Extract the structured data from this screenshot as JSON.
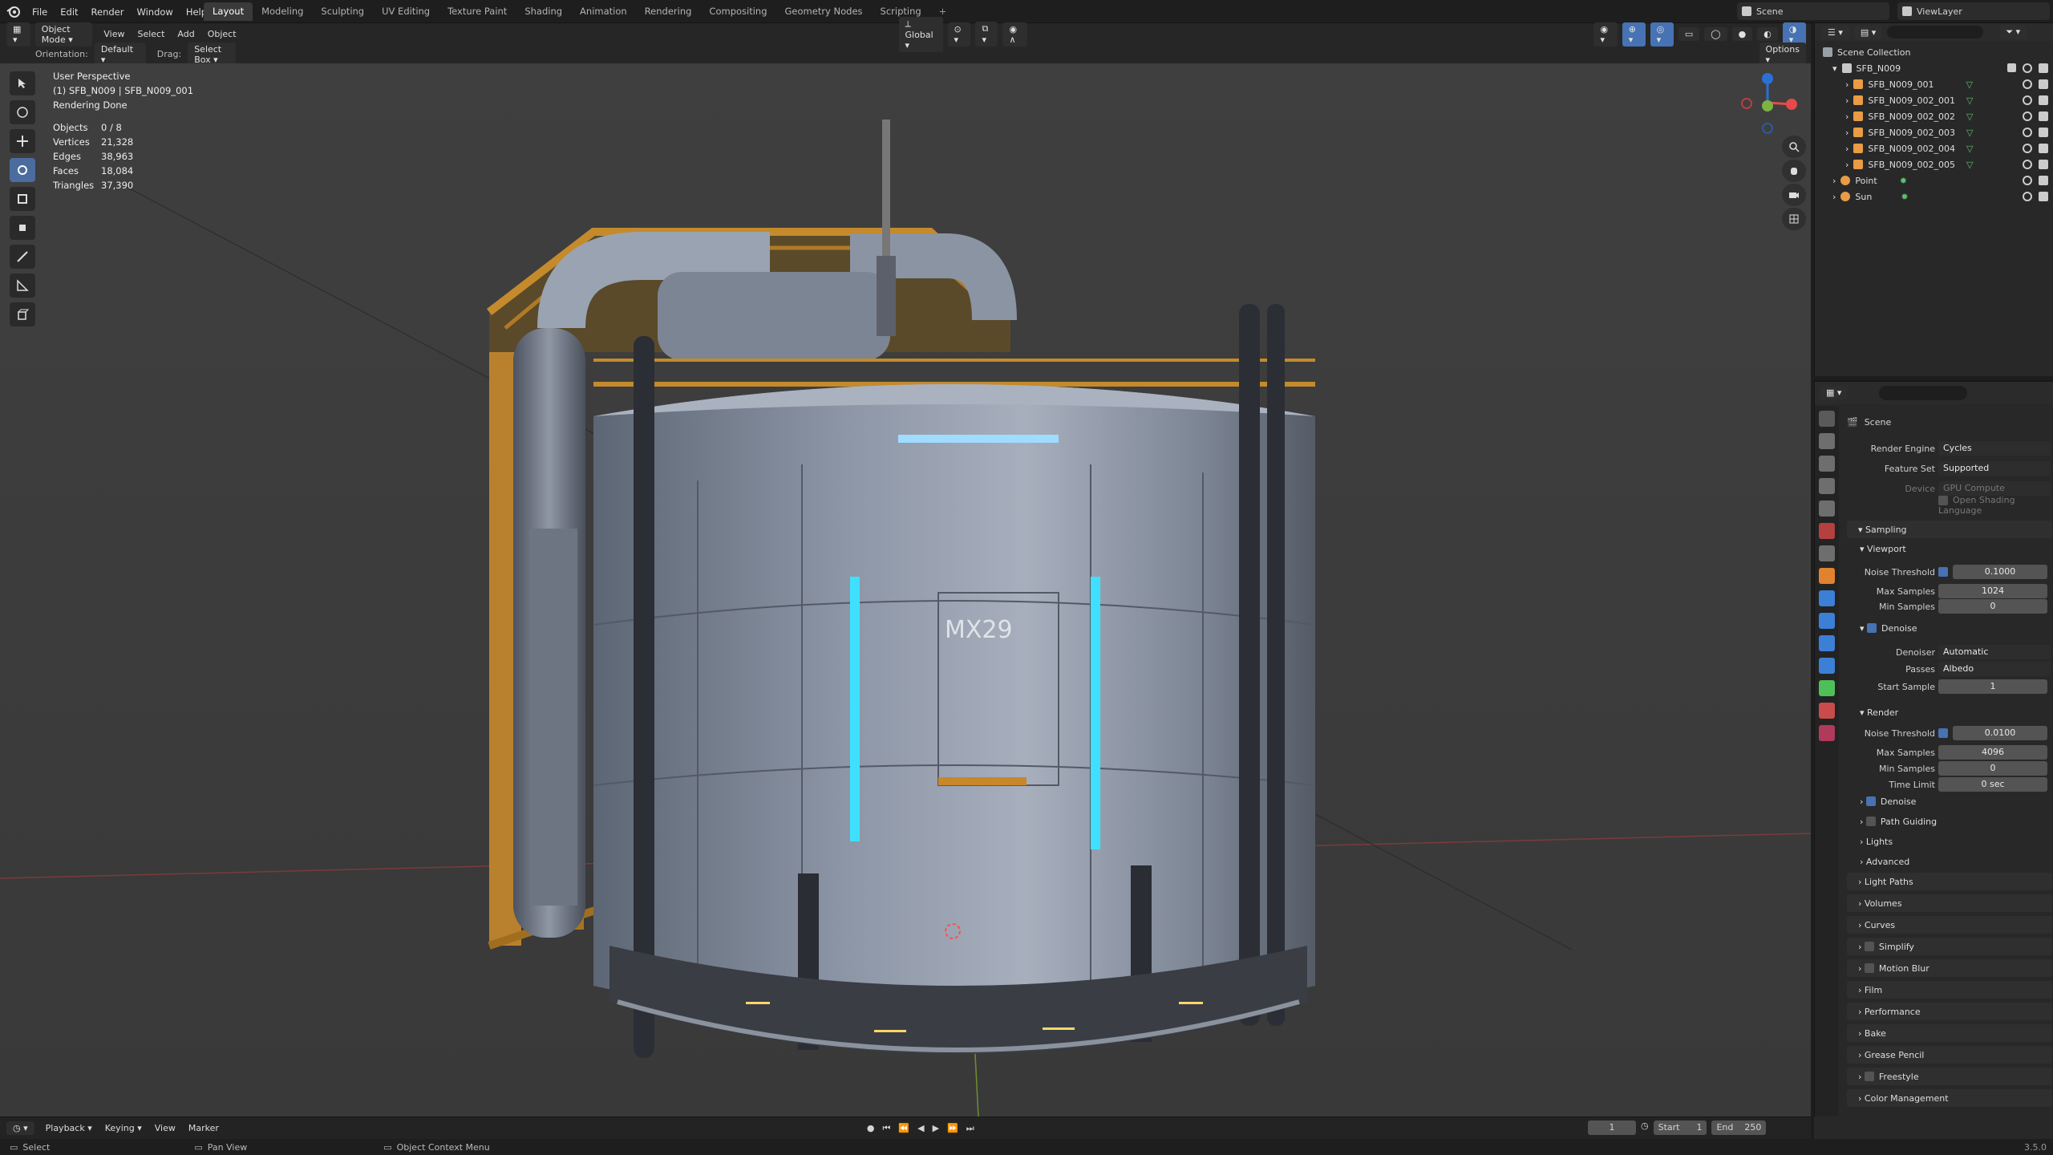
{
  "topbar": {
    "menus": [
      "File",
      "Edit",
      "Render",
      "Window",
      "Help"
    ],
    "workspaces": [
      "Layout",
      "Modeling",
      "Sculpting",
      "UV Editing",
      "Texture Paint",
      "Shading",
      "Animation",
      "Rendering",
      "Compositing",
      "Geometry Nodes",
      "Scripting"
    ],
    "active_workspace": "Layout",
    "scene": "Scene",
    "view_layer": "ViewLayer"
  },
  "viewport_header": {
    "mode": "Object Mode",
    "menus": [
      "View",
      "Select",
      "Add",
      "Object"
    ],
    "transform": "Global",
    "orientation_label": "Orientation:",
    "orientation_value": "Default",
    "drag_label": "Drag:",
    "drag_value": "Select Box",
    "options": "Options"
  },
  "overlay": {
    "perspective": "User Perspective",
    "object": "(1) SFB_N009 | SFB_N009_001",
    "render_status": "Rendering Done",
    "stats": [
      {
        "label": "Objects",
        "value": "0 / 8"
      },
      {
        "label": "Vertices",
        "value": "21,328"
      },
      {
        "label": "Edges",
        "value": "38,963"
      },
      {
        "label": "Faces",
        "value": "18,084"
      },
      {
        "label": "Triangles",
        "value": "37,390"
      }
    ],
    "model_text": "MX29"
  },
  "outliner": {
    "root": "Scene Collection",
    "collection": "SFB_N009",
    "objects": [
      "SFB_N009_001",
      "SFB_N009_002_001",
      "SFB_N009_002_002",
      "SFB_N009_002_003",
      "SFB_N009_002_004",
      "SFB_N009_002_005"
    ],
    "extras": [
      "Point",
      "Sun"
    ]
  },
  "properties": {
    "context": "Scene",
    "render_engine_label": "Render Engine",
    "render_engine": "Cycles",
    "feature_set_label": "Feature Set",
    "feature_set": "Supported",
    "device_label": "Device",
    "device": "GPU Compute",
    "osl_label": "Open Shading Language",
    "sampling": "Sampling",
    "viewport": "Viewport",
    "noise_threshold_label": "Noise Threshold",
    "vp_noise": "0.1000",
    "max_samples_label": "Max Samples",
    "vp_max": "1024",
    "min_samples_label": "Min Samples",
    "vp_min": "0",
    "denoise_label": "Denoise",
    "denoiser_label": "Denoiser",
    "denoiser": "Automatic",
    "passes_label": "Passes",
    "passes": "Albedo",
    "start_sample_label": "Start Sample",
    "start_sample": "1",
    "render": "Render",
    "r_noise": "0.0100",
    "r_max": "4096",
    "r_min": "0",
    "time_limit_label": "Time Limit",
    "time_limit": "0 sec",
    "path_guiding": "Path Guiding",
    "lights": "Lights",
    "advanced": "Advanced",
    "sections": [
      "Light Paths",
      "Volumes",
      "Curves",
      "Simplify",
      "Motion Blur",
      "Film",
      "Performance",
      "Bake",
      "Grease Pencil",
      "Freestyle",
      "Color Management"
    ]
  },
  "timeline": {
    "menus": [
      "Playback",
      "Keying",
      "View",
      "Marker"
    ],
    "current_frame": "1",
    "start_label": "Start",
    "start": "1",
    "end_label": "End",
    "end": "250"
  },
  "statusbar": {
    "select": "Select",
    "pan": "Pan View",
    "context": "Object Context Menu",
    "version": "3.5.0"
  }
}
